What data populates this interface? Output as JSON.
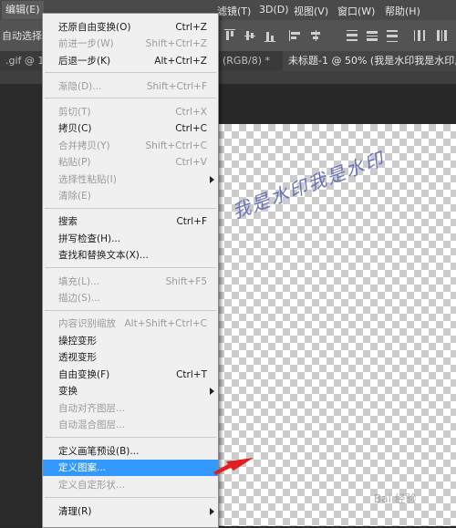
{
  "menubar": {
    "edit": "编辑(E)",
    "filter": "滤镜(T)",
    "threed": "3D(D)",
    "view": "视图(V)",
    "window": "窗口(W)",
    "help": "帮助(H)"
  },
  "options": {
    "auto_select": "自动选择："
  },
  "tabs": [
    {
      "label": ".gif @ 100"
    },
    {
      "label": "(RGB/8) *"
    },
    {
      "label": "未标题-1 @ 50% (我是水印我是水印,"
    }
  ],
  "menu": {
    "undo": {
      "label": "还原自由变换(O)",
      "shortcut": "Ctrl+Z"
    },
    "step_forward": {
      "label": "前进一步(W)",
      "shortcut": "Shift+Ctrl+Z"
    },
    "step_back": {
      "label": "后退一步(K)",
      "shortcut": "Alt+Ctrl+Z"
    },
    "fade": {
      "label": "渐隐(D)...",
      "shortcut": "Shift+Ctrl+F"
    },
    "cut": {
      "label": "剪切(T)",
      "shortcut": "Ctrl+X"
    },
    "copy": {
      "label": "拷贝(C)",
      "shortcut": "Ctrl+C"
    },
    "copy_merged": {
      "label": "合并拷贝(Y)",
      "shortcut": "Shift+Ctrl+C"
    },
    "paste": {
      "label": "粘贴(P)",
      "shortcut": "Ctrl+V"
    },
    "paste_special": {
      "label": "选择性粘贴(I)"
    },
    "clear": {
      "label": "清除(E)"
    },
    "search": {
      "label": "搜索",
      "shortcut": "Ctrl+F"
    },
    "spell_check": {
      "label": "拼写检查(H)..."
    },
    "find_replace": {
      "label": "查找和替换文本(X)..."
    },
    "fill": {
      "label": "填充(L)...",
      "shortcut": "Shift+F5"
    },
    "stroke": {
      "label": "描边(S)..."
    },
    "content_aware_scale": {
      "label": "内容识别缩放",
      "shortcut": "Alt+Shift+Ctrl+C"
    },
    "puppet_warp": {
      "label": "操控变形"
    },
    "perspective_warp": {
      "label": "透视变形"
    },
    "free_transform": {
      "label": "自由变换(F)",
      "shortcut": "Ctrl+T"
    },
    "transform": {
      "label": "变换"
    },
    "auto_align": {
      "label": "自动对齐图层..."
    },
    "auto_blend": {
      "label": "自动混合图层..."
    },
    "define_brush": {
      "label": "定义画笔预设(B)..."
    },
    "define_pattern": {
      "label": "定义图案..."
    },
    "define_shape": {
      "label": "定义自定形状..."
    },
    "purge": {
      "label": "清理(R)"
    }
  },
  "canvas": {
    "watermark": "我是水印我是水印"
  },
  "watermark_site": "Bai 经验",
  "colors": {
    "highlight": "#3399ff",
    "arrow": "#e02020",
    "watermark": "#5560b0"
  }
}
